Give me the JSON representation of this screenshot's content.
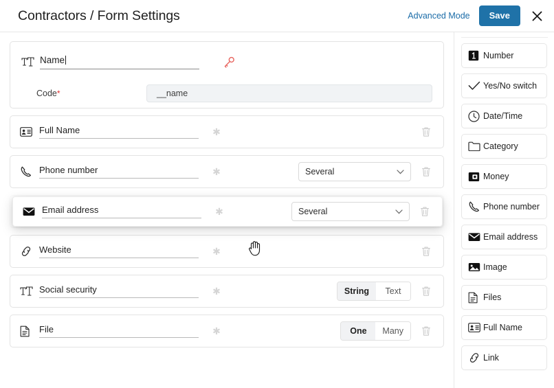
{
  "header": {
    "title": "Contractors / Form Settings",
    "advanced_mode_label": "Advanced Mode",
    "save_label": "Save",
    "close_label": "✕",
    "save_color": "#1f72a8",
    "link_color": "#1b6ca8"
  },
  "primary_field": {
    "icon": "text-type-icon",
    "name_value": "Name",
    "key_icon": "key-icon",
    "key_color": "#e8655f",
    "code_label": "Code",
    "code_required_marker": "*",
    "code_value": "__name"
  },
  "required_marker": "✱",
  "fields": [
    {
      "icon": "id-card-icon",
      "name": "Full Name",
      "required_marker": "✱",
      "control": "none",
      "delete_icon": "trash-icon"
    },
    {
      "icon": "phone-icon",
      "name": "Phone number",
      "required_marker": "✱",
      "control": "select",
      "select_value": "Several",
      "delete_icon": "trash-icon"
    },
    {
      "icon": "envelope-icon",
      "name": "Email address",
      "required_marker": "✱",
      "control": "select",
      "select_value": "Several",
      "delete_icon": "trash-icon"
    },
    {
      "icon": "link-icon",
      "name": "Website",
      "required_marker": "✱",
      "control": "none",
      "delete_icon": "trash-icon"
    },
    {
      "icon": "text-type-icon",
      "name": "Social security",
      "required_marker": "✱",
      "control": "segmented",
      "segments": [
        "String",
        "Text"
      ],
      "selected_segment": "String",
      "delete_icon": "trash-icon"
    },
    {
      "icon": "file-icon",
      "name": "File",
      "required_marker": "✱",
      "control": "segmented",
      "segments": [
        "One",
        "Many"
      ],
      "selected_segment": "One",
      "delete_icon": "trash-icon"
    }
  ],
  "drag": {
    "icon": "envelope-icon",
    "name": "Email address",
    "required_marker": "✱",
    "select_value": "Several",
    "delete_icon": "trash-icon",
    "cursor": "grab-hand-cursor"
  },
  "sidebar": {
    "items": [
      {
        "icon": "number-icon",
        "label": "Number"
      },
      {
        "icon": "check-icon",
        "label": "Yes/No switch"
      },
      {
        "icon": "clock-icon",
        "label": "Date/Time"
      },
      {
        "icon": "folder-icon",
        "label": "Category"
      },
      {
        "icon": "money-icon",
        "label": "Money"
      },
      {
        "icon": "phone-icon",
        "label": "Phone number"
      },
      {
        "icon": "envelope-icon",
        "label": "Email address"
      },
      {
        "icon": "image-icon",
        "label": "Image"
      },
      {
        "icon": "file-icon",
        "label": "Files"
      },
      {
        "icon": "id-card-icon",
        "label": "Full Name"
      },
      {
        "icon": "link-icon",
        "label": "Link"
      }
    ]
  }
}
